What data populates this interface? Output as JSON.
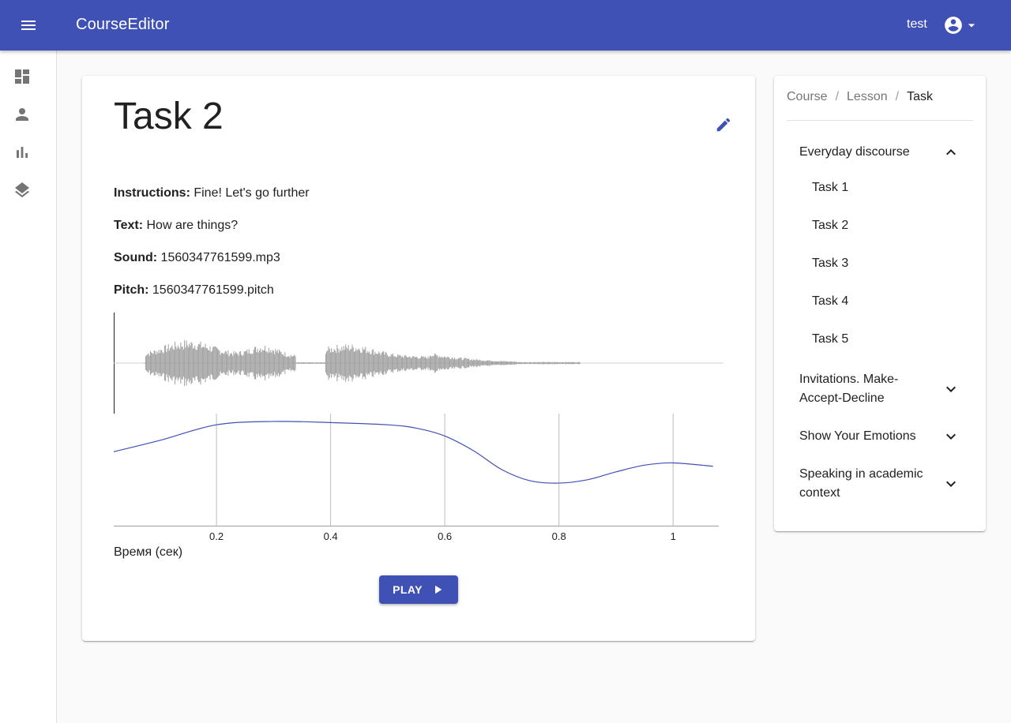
{
  "appbar": {
    "title": "CourseEditor",
    "username": "test"
  },
  "drawer": {
    "items": [
      "dashboard-icon",
      "person-icon",
      "bar-chart-icon",
      "layers-icon"
    ]
  },
  "task": {
    "title": "Task 2",
    "fields": {
      "instructions": {
        "label": "Instructions:",
        "value": "Fine! Let's go further"
      },
      "text": {
        "label": "Text:",
        "value": "How are things?"
      },
      "sound": {
        "label": "Sound:",
        "value": "1560347761599.mp3"
      },
      "pitch": {
        "label": "Pitch:",
        "value": "1560347761599.pitch"
      }
    },
    "play_label": "PLAY"
  },
  "chart_data": {
    "type": "line",
    "xlabel": "Время (сек)",
    "ylabel": "",
    "xlim": [
      0.02,
      1.08
    ],
    "x_ticks": [
      0.2,
      0.4,
      0.6,
      0.8,
      1
    ],
    "x_tick_labels": [
      "0.2",
      "0.4",
      "0.6",
      "0.8",
      "1"
    ],
    "grid": "vertical",
    "series": [
      {
        "x": [
          0.02,
          0.1,
          0.2,
          0.3,
          0.4,
          0.5,
          0.55,
          0.6,
          0.65,
          0.7,
          0.75,
          0.8,
          0.85,
          0.9,
          0.95,
          1.0,
          1.07
        ],
        "y": [
          0.66,
          0.76,
          0.9,
          0.93,
          0.92,
          0.9,
          0.87,
          0.8,
          0.67,
          0.5,
          0.4,
          0.38,
          0.41,
          0.48,
          0.54,
          0.56,
          0.53
        ]
      }
    ]
  },
  "sidebar": {
    "breadcrumb": [
      "Course",
      "Lesson",
      "Task"
    ],
    "sections": [
      {
        "label": "Everyday discourse",
        "expanded": true,
        "tasks": [
          "Task 1",
          "Task 2",
          "Task 3",
          "Task 4",
          "Task 5"
        ]
      },
      {
        "label": "Invitations. Make-Accept-Decline",
        "expanded": false
      },
      {
        "label": "Show Your Emotions",
        "expanded": false
      },
      {
        "label": "Speaking in academic context",
        "expanded": false
      }
    ]
  },
  "colors": {
    "primary": "#3f51b5",
    "waveform": "#9e9e9e",
    "pitch_line": "#3f51b5"
  }
}
